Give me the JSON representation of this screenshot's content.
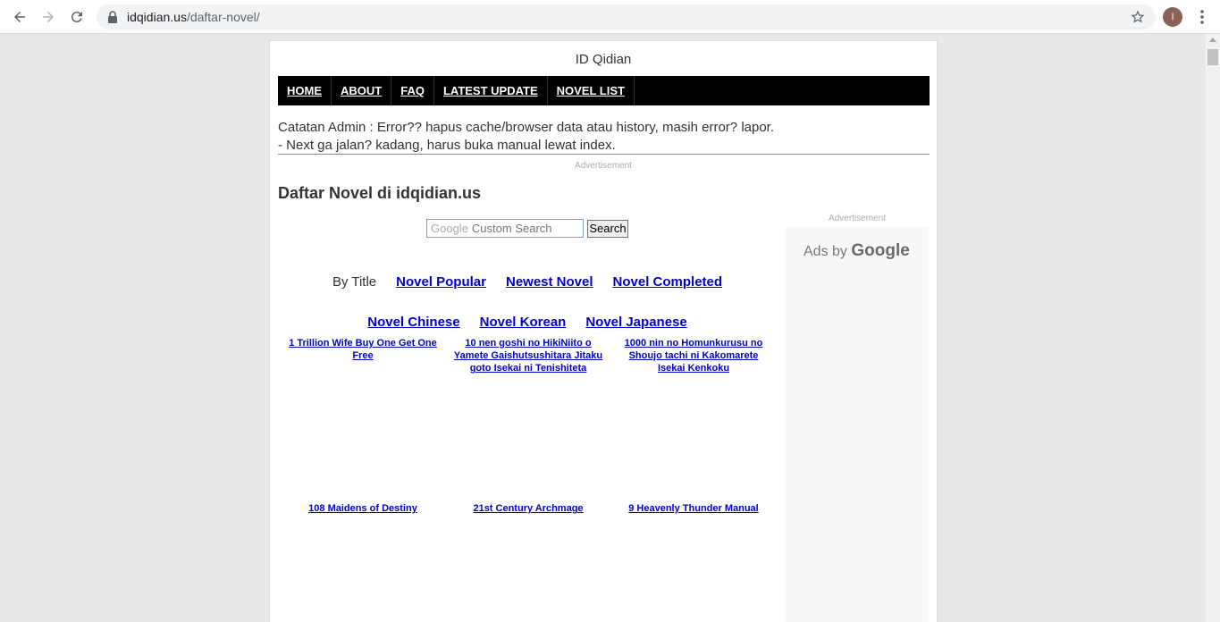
{
  "browser": {
    "url_host": "idqidian.us",
    "url_path": "/daftar-novel/",
    "avatar_initial": "I"
  },
  "site": {
    "title": "ID Qidian",
    "nav": [
      "HOME",
      "ABOUT",
      "FAQ",
      "LATEST UPDATE",
      "NOVEL LIST"
    ],
    "notice_line1": "Catatan Admin : Error?? hapus cache/browser data atau history, masih error? lapor.",
    "notice_line2": "- Next ga jalan? kadang, harus buka manual lewat index.",
    "ad_label": "Advertisement",
    "heading": "Daftar Novel di idqidian.us"
  },
  "search": {
    "google_word": "Google",
    "placeholder": "Custom Search",
    "button": "Search"
  },
  "filters": {
    "by_title": "By Title",
    "row1": [
      "Novel Popular",
      "Newest Novel",
      "Novel Completed"
    ],
    "row2": [
      "Novel Chinese",
      "Novel Korean",
      "Novel Japanese"
    ]
  },
  "novels": [
    "1 Trillion Wife Buy One Get One Free",
    "10 nen goshi no HikiNiito o Yamete Gaishutsushitara Jitaku goto Isekai ni Tenishiteta",
    "1000 nin no Homunkurusu no Shoujo tachi ni Kakomarete Isekai Kenkoku",
    "108 Maidens of Destiny",
    "21st Century Archmage",
    "9 Heavenly Thunder Manual"
  ],
  "side_ad": {
    "label": "Advertisement",
    "ads_by": "Ads by",
    "google": "Google"
  }
}
